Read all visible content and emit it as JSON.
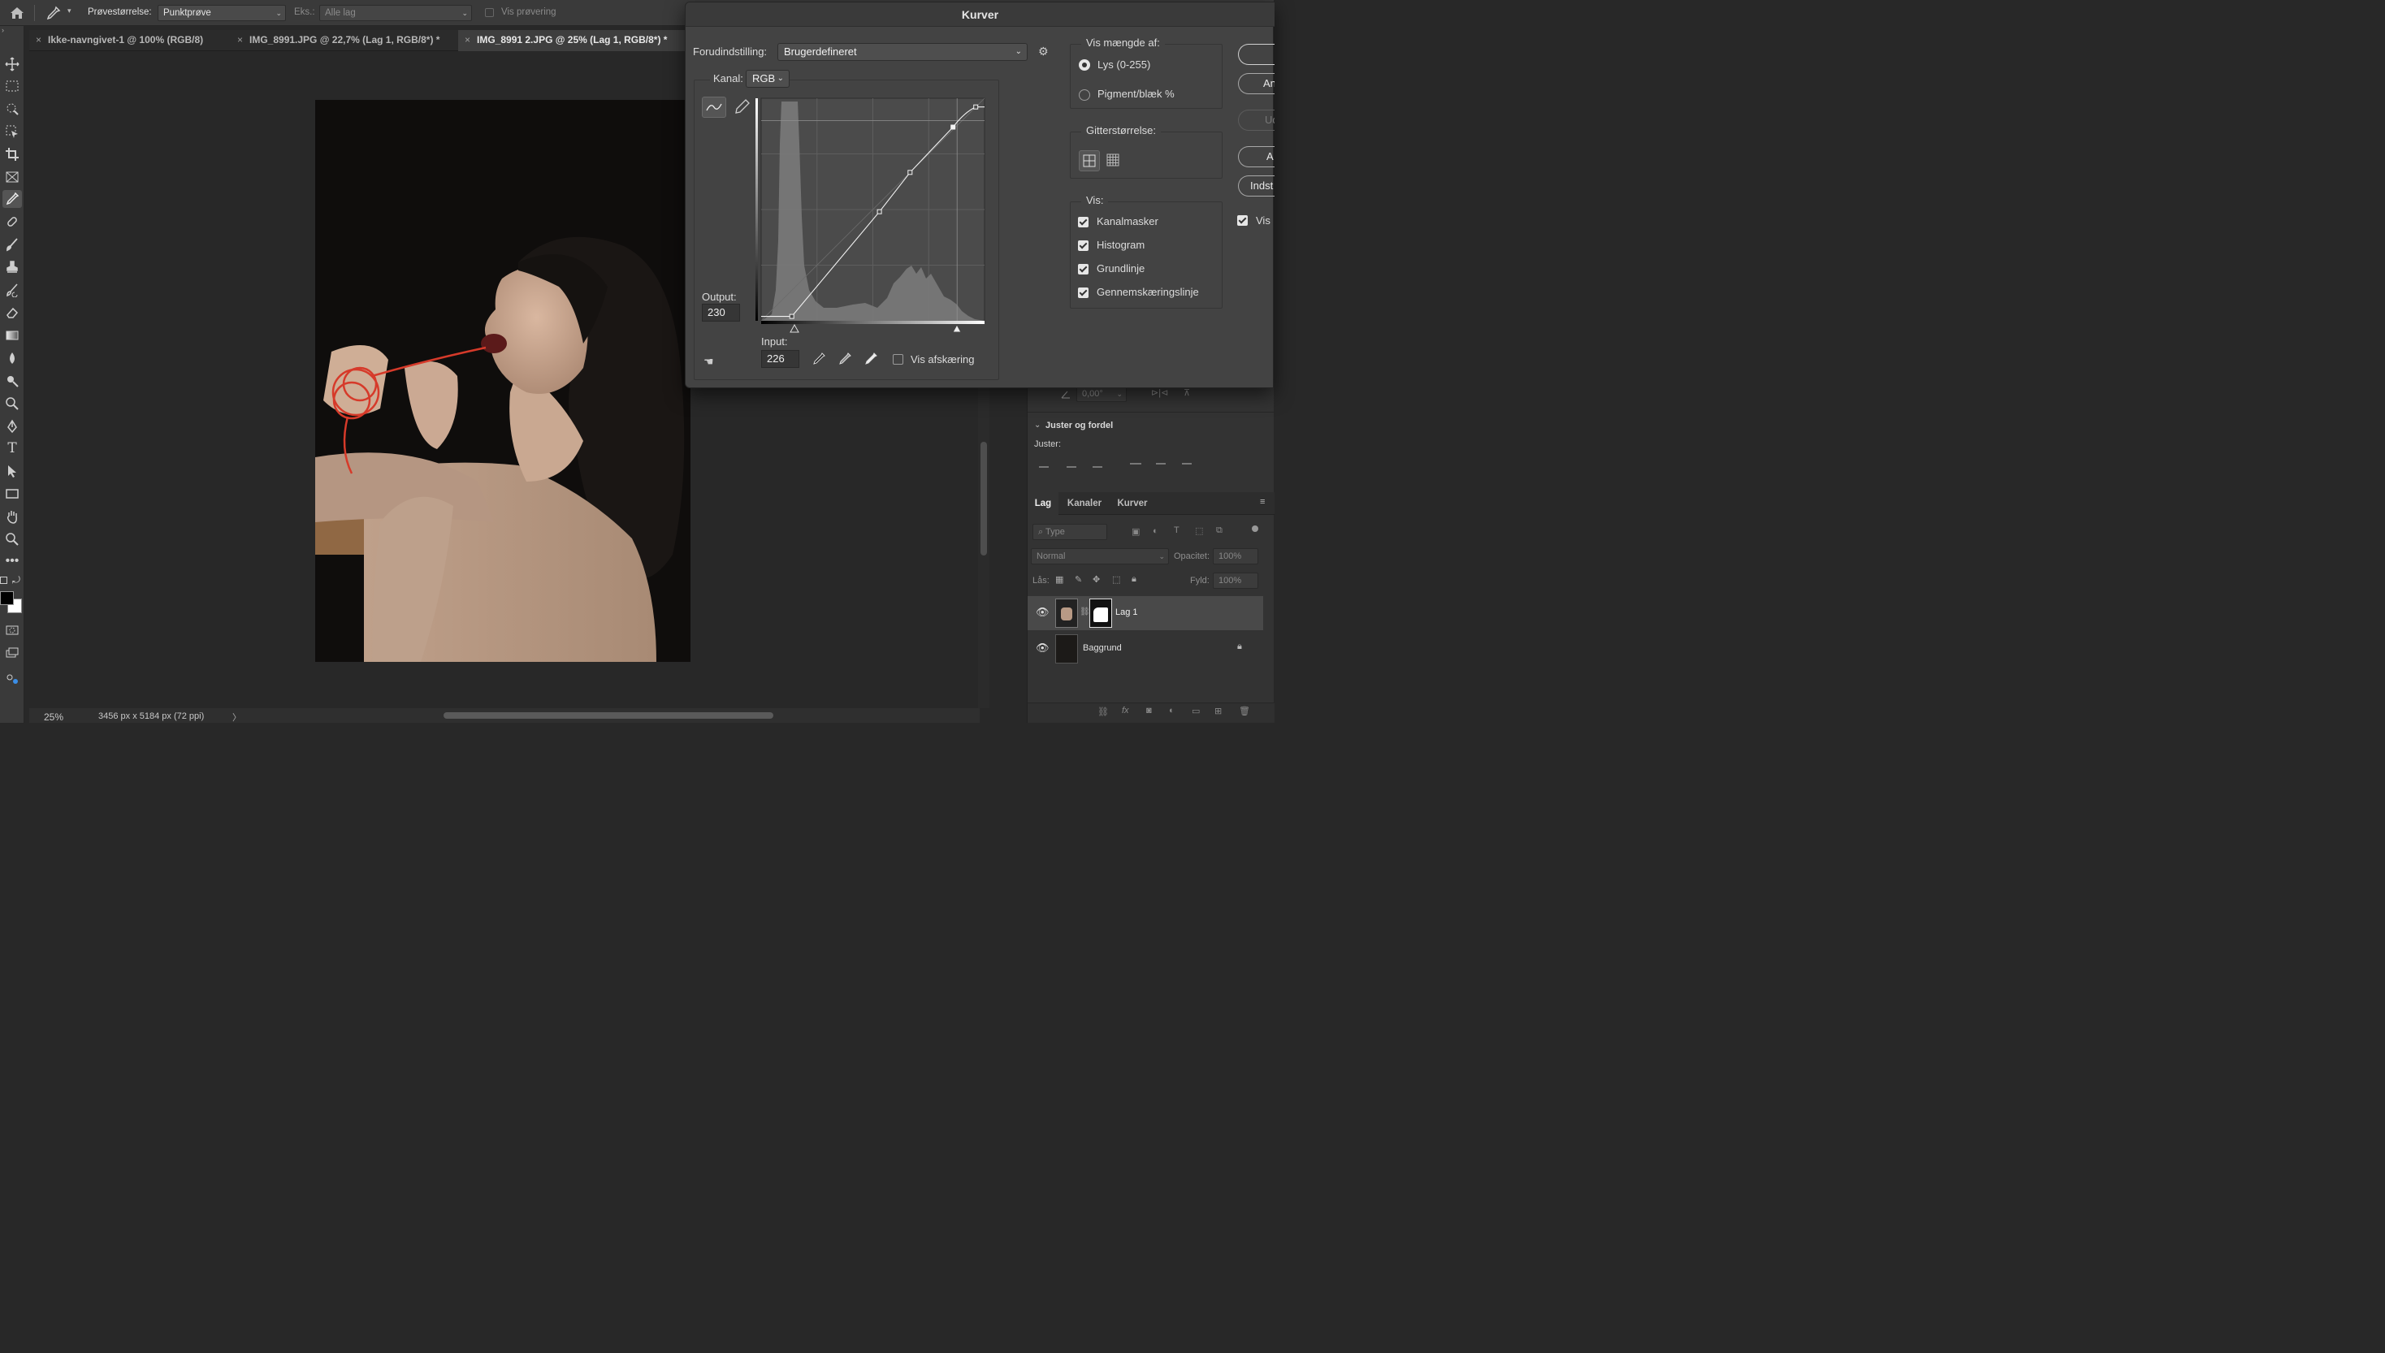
{
  "optbar": {
    "sample_size_label": "Prøvestørrelse:",
    "sample_size_value": "Punktprøve",
    "sample_label": "Eks.:",
    "sample_value": "Alle lag",
    "show_ring_label": "Vis prøvering"
  },
  "tabs": [
    {
      "label": "Ikke-navngivet-1 @ 100% (RGB/8)",
      "active": false
    },
    {
      "label": "IMG_8991.JPG @ 22,7% (Lag 1, RGB/8*) *",
      "active": false
    },
    {
      "label": "IMG_8991 2.JPG @ 25% (Lag 1, RGB/8*) *",
      "active": true
    }
  ],
  "status": {
    "zoom": "25%",
    "dimensions": "3456 px x 5184 px (72 ppi)",
    "arrow": "〉"
  },
  "curves": {
    "title": "Kurver",
    "preset_label": "Forudindstilling:",
    "preset_value": "Brugerdefineret",
    "channel_label": "Kanal:",
    "channel_value": "RGB",
    "output_label": "Output:",
    "output_value": "230",
    "input_label": "Input:",
    "input_value": "226",
    "show_clipping_label": "Vis afskæring",
    "show_clipping_checked": false,
    "amount_group_label": "Vis mængde af:",
    "amount_options": [
      {
        "label": "Lys (0-255)",
        "selected": true
      },
      {
        "label": "Pigment/blæk %",
        "selected": false
      }
    ],
    "grid_size_label": "Gitterstørrelse:",
    "show_label": "Vis:",
    "show_options": [
      {
        "label": "Kanalmasker",
        "checked": true
      },
      {
        "label": "Histogram",
        "checked": true
      },
      {
        "label": "Grundlinje",
        "checked": true
      },
      {
        "label": "Gennemskæringslinje",
        "checked": true
      }
    ],
    "buttons": [
      "",
      "An",
      "Ud",
      "A",
      "Indst"
    ],
    "preview_label": "Vis",
    "preview_checked": true,
    "curve_points": [
      [
        35,
        5
      ],
      [
        135,
        125
      ],
      [
        170,
        170
      ],
      [
        219,
        222
      ],
      [
        245,
        245
      ]
    ]
  },
  "properties": {
    "angle_value": "0,00°",
    "align_section": "Juster og fordel",
    "align_label": "Juster:"
  },
  "layers_panel": {
    "tabs": [
      "Lag",
      "Kanaler",
      "Kurver"
    ],
    "filter_placeholder": "Type",
    "blend_mode": "Normal",
    "opacity_label": "Opacitet:",
    "opacity_value": "100%",
    "lock_label": "Lås:",
    "fill_label": "Fyld:",
    "fill_value": "100%",
    "layers": [
      {
        "name": "Lag 1",
        "selected": true,
        "has_mask": true,
        "locked": false
      },
      {
        "name": "Baggrund",
        "selected": false,
        "has_mask": false,
        "locked": true
      }
    ]
  }
}
